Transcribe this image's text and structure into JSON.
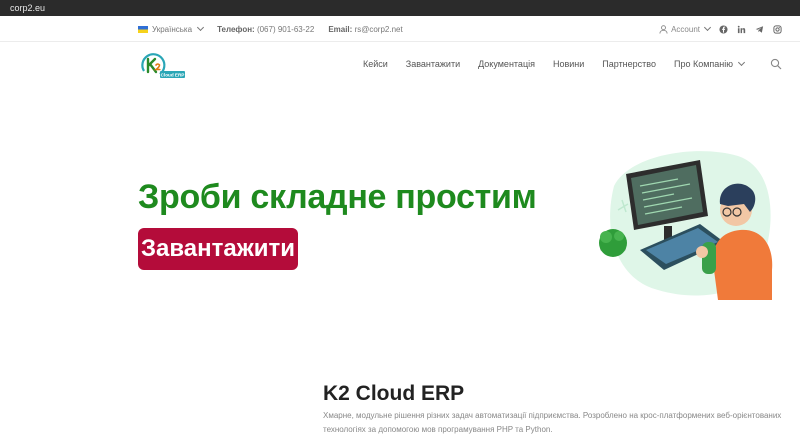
{
  "browser": {
    "url": "corp2.eu"
  },
  "topbar": {
    "language": "Українська",
    "phone_label": "Телефон:",
    "phone_value": "(067) 901-63-22",
    "email_label": "Email:",
    "email_value": "rs@corp2.net",
    "account_label": "Account"
  },
  "logo": {
    "text": "Cloud ERP"
  },
  "nav": {
    "items": [
      "Кейси",
      "Завантажити",
      "Документація",
      "Новини",
      "Партнерство",
      "Про Компанію"
    ]
  },
  "hero": {
    "title": "Зроби складне простим",
    "button_label": "Завантажити"
  },
  "about": {
    "title": "K2 Cloud ERP",
    "description": "Хмарне, модульне рішення різних задач автоматизації підприємства. Розроблено на крос-платформених веб-орієнтованих технологіях за допомогою мов програмування PHP та Python."
  },
  "colors": {
    "hero_title": "#1e8a1e",
    "button_bg": "#b40c3a",
    "illustration_bg": "#dff6e8"
  }
}
